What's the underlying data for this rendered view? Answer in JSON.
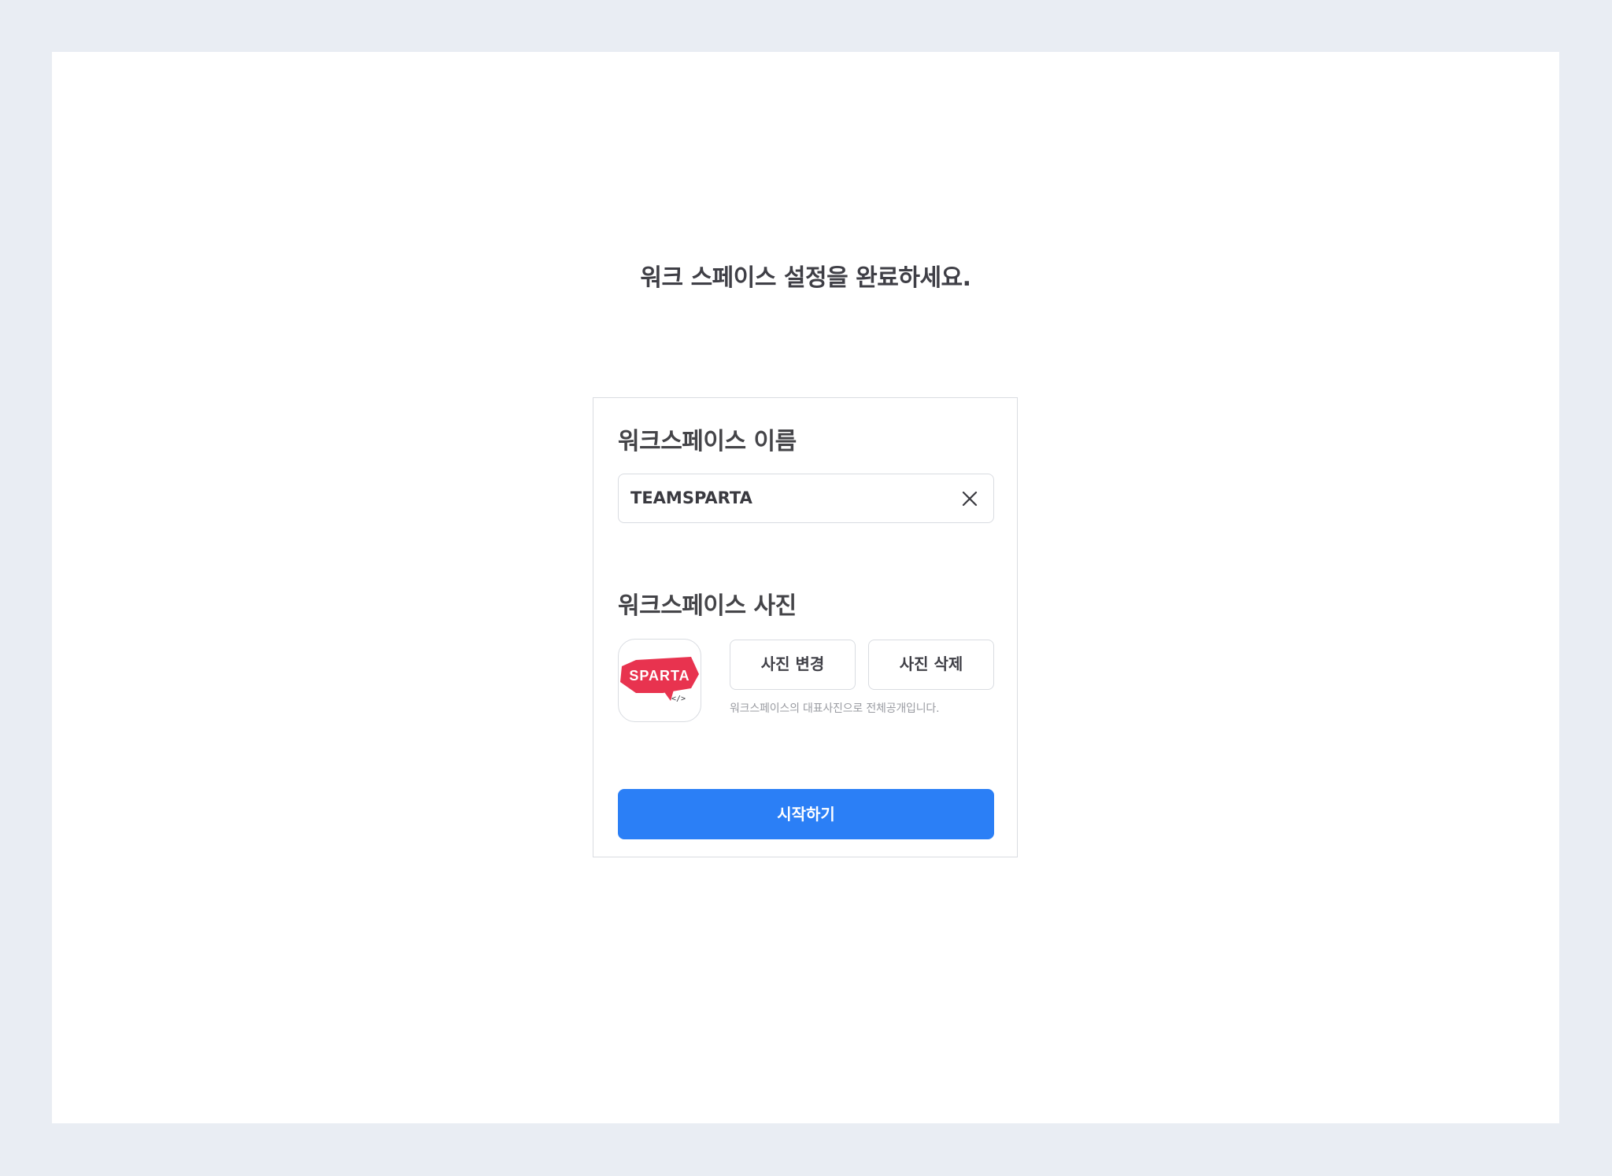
{
  "page": {
    "title": "워크 스페이스 설정을 완료하세요."
  },
  "workspace_name": {
    "section_title": "워크스페이스 이름",
    "value": "TEAMSPARTA",
    "clear_icon": "close-icon"
  },
  "workspace_photo": {
    "section_title": "워크스페이스 사진",
    "logo_text": "SPARTA",
    "change_label": "사진 변경",
    "delete_label": "사진 삭제",
    "hint": "워크스페이스의 대표사진으로 전체공개입니다."
  },
  "actions": {
    "start_label": "시작하기"
  },
  "colors": {
    "background": "#e9edf3",
    "primary": "#2b7ff6",
    "logo_red": "#e8334f"
  }
}
